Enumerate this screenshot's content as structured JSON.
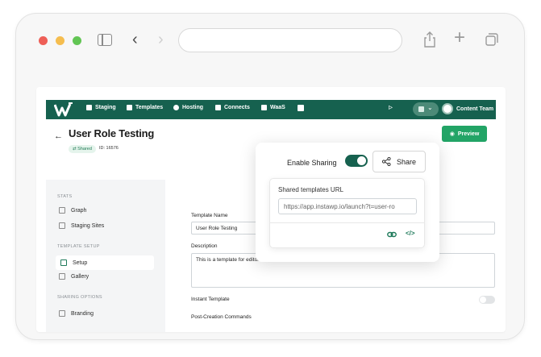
{
  "browser": {
    "address": "",
    "icons": [
      "sidebar-toggle-icon",
      "back-icon",
      "forward-icon",
      "share-icon",
      "new-tab-icon",
      "tabs-icon"
    ]
  },
  "nav": {
    "items": [
      {
        "label": "Staging",
        "icon": "cube-icon"
      },
      {
        "label": "Templates",
        "icon": "templates-icon"
      },
      {
        "label": "Hosting",
        "icon": "cloud-icon"
      },
      {
        "label": "Connects",
        "icon": "connects-icon"
      },
      {
        "label": "WaaS",
        "icon": "waas-icon"
      }
    ],
    "team": "Content Team"
  },
  "header": {
    "title": "User Role Testing",
    "badge": "Shared",
    "id_label": "ID: 16576",
    "preview": "Preview"
  },
  "sidebar": {
    "stats_heading": "STATS",
    "stats_items": [
      "Graph",
      "Staging Sites"
    ],
    "setup_heading": "TEMPLATE SETUP",
    "setup_items": [
      "Setup",
      "Gallery"
    ],
    "sharing_heading": "SHARING OPTIONS",
    "sharing_items": [
      "Branding"
    ]
  },
  "form": {
    "name_label": "Template Name",
    "name_value": "User Role Testing",
    "desc_label": "Description",
    "desc_value": "This is a template for editors",
    "instant_label": "Instant Template",
    "post_label": "Post-Creation Commands"
  },
  "popover": {
    "enable_label": "Enable Sharing",
    "share_label": "Share",
    "url_title": "Shared templates URL",
    "url_value": "https://app.instawp.io/launch?t=user-ro"
  },
  "colors": {
    "brand": "#16614f",
    "accent": "#22a466"
  }
}
